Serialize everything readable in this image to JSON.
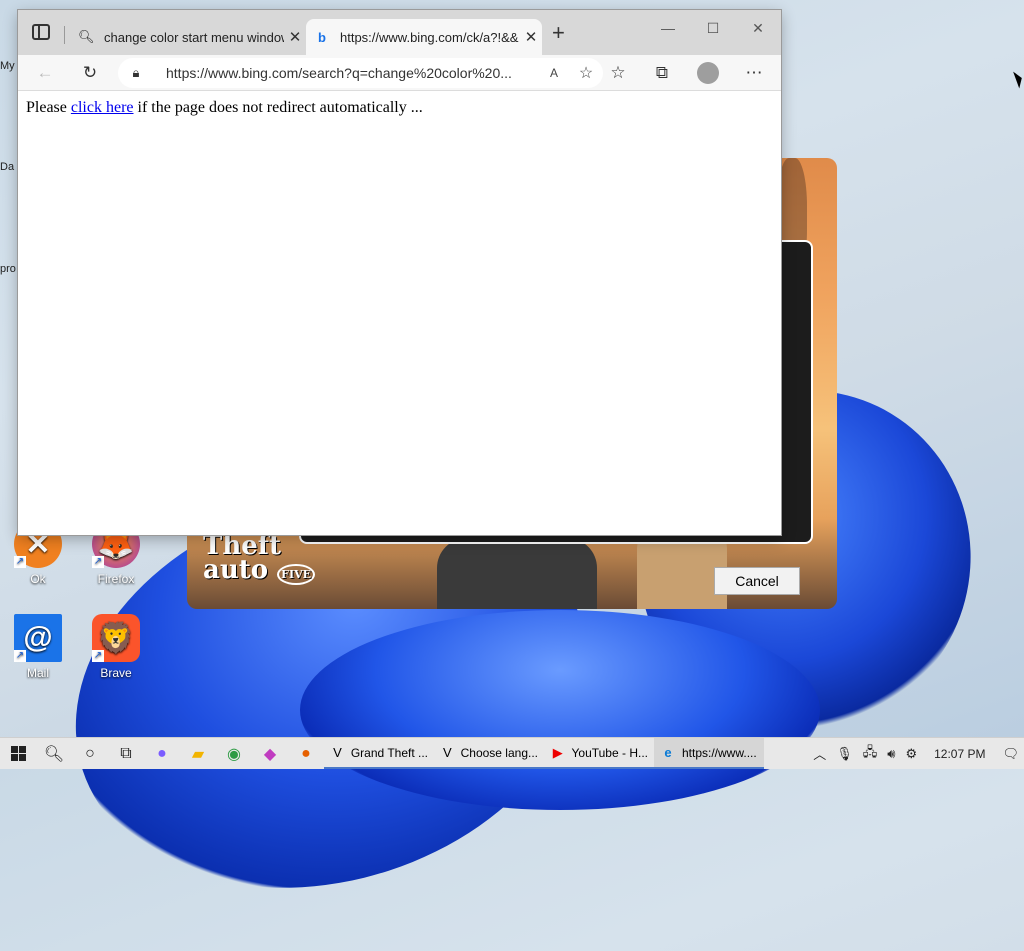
{
  "desktop": {
    "edge_labels": [
      "My",
      "Da",
      "pro"
    ],
    "icons": [
      {
        "label": "Ok",
        "glyph": "✕",
        "color": "#f08020"
      },
      {
        "label": "Firefox",
        "glyph": "🦊",
        "color": "#e66000"
      },
      {
        "label": "Mail",
        "glyph": "@",
        "color": "#1a73e8"
      },
      {
        "label": "Brave",
        "glyph": "🦁",
        "color": "#fb542b"
      }
    ]
  },
  "launcher": {
    "logo_line1": "Theft",
    "logo_line2": "auto",
    "logo_badge": "FIVE",
    "cancel_label": "Cancel"
  },
  "browser": {
    "tabs": [
      {
        "favicon": "search-icon",
        "title": "change color start menu window"
      },
      {
        "favicon": "bing-icon",
        "title": "https://www.bing.com/ck/a?!&&"
      }
    ],
    "address_url": "https://www.bing.com/search?q=change%20color%20...",
    "read_aloud": "A",
    "page": {
      "prefix": "Please ",
      "link": "click here",
      "suffix": " if the page does not redirect automatically ..."
    }
  },
  "taskbar": {
    "apps": [
      {
        "label": "Grand Theft ...",
        "icon": "V"
      },
      {
        "label": "Choose lang...",
        "icon": "V"
      },
      {
        "label": "YouTube - H...",
        "icon": "▶"
      },
      {
        "label": "https://www....",
        "icon": "e"
      }
    ],
    "clock": "12:07 PM"
  },
  "colors": {
    "accent": "#4a78c8",
    "link": "#0000ee"
  }
}
